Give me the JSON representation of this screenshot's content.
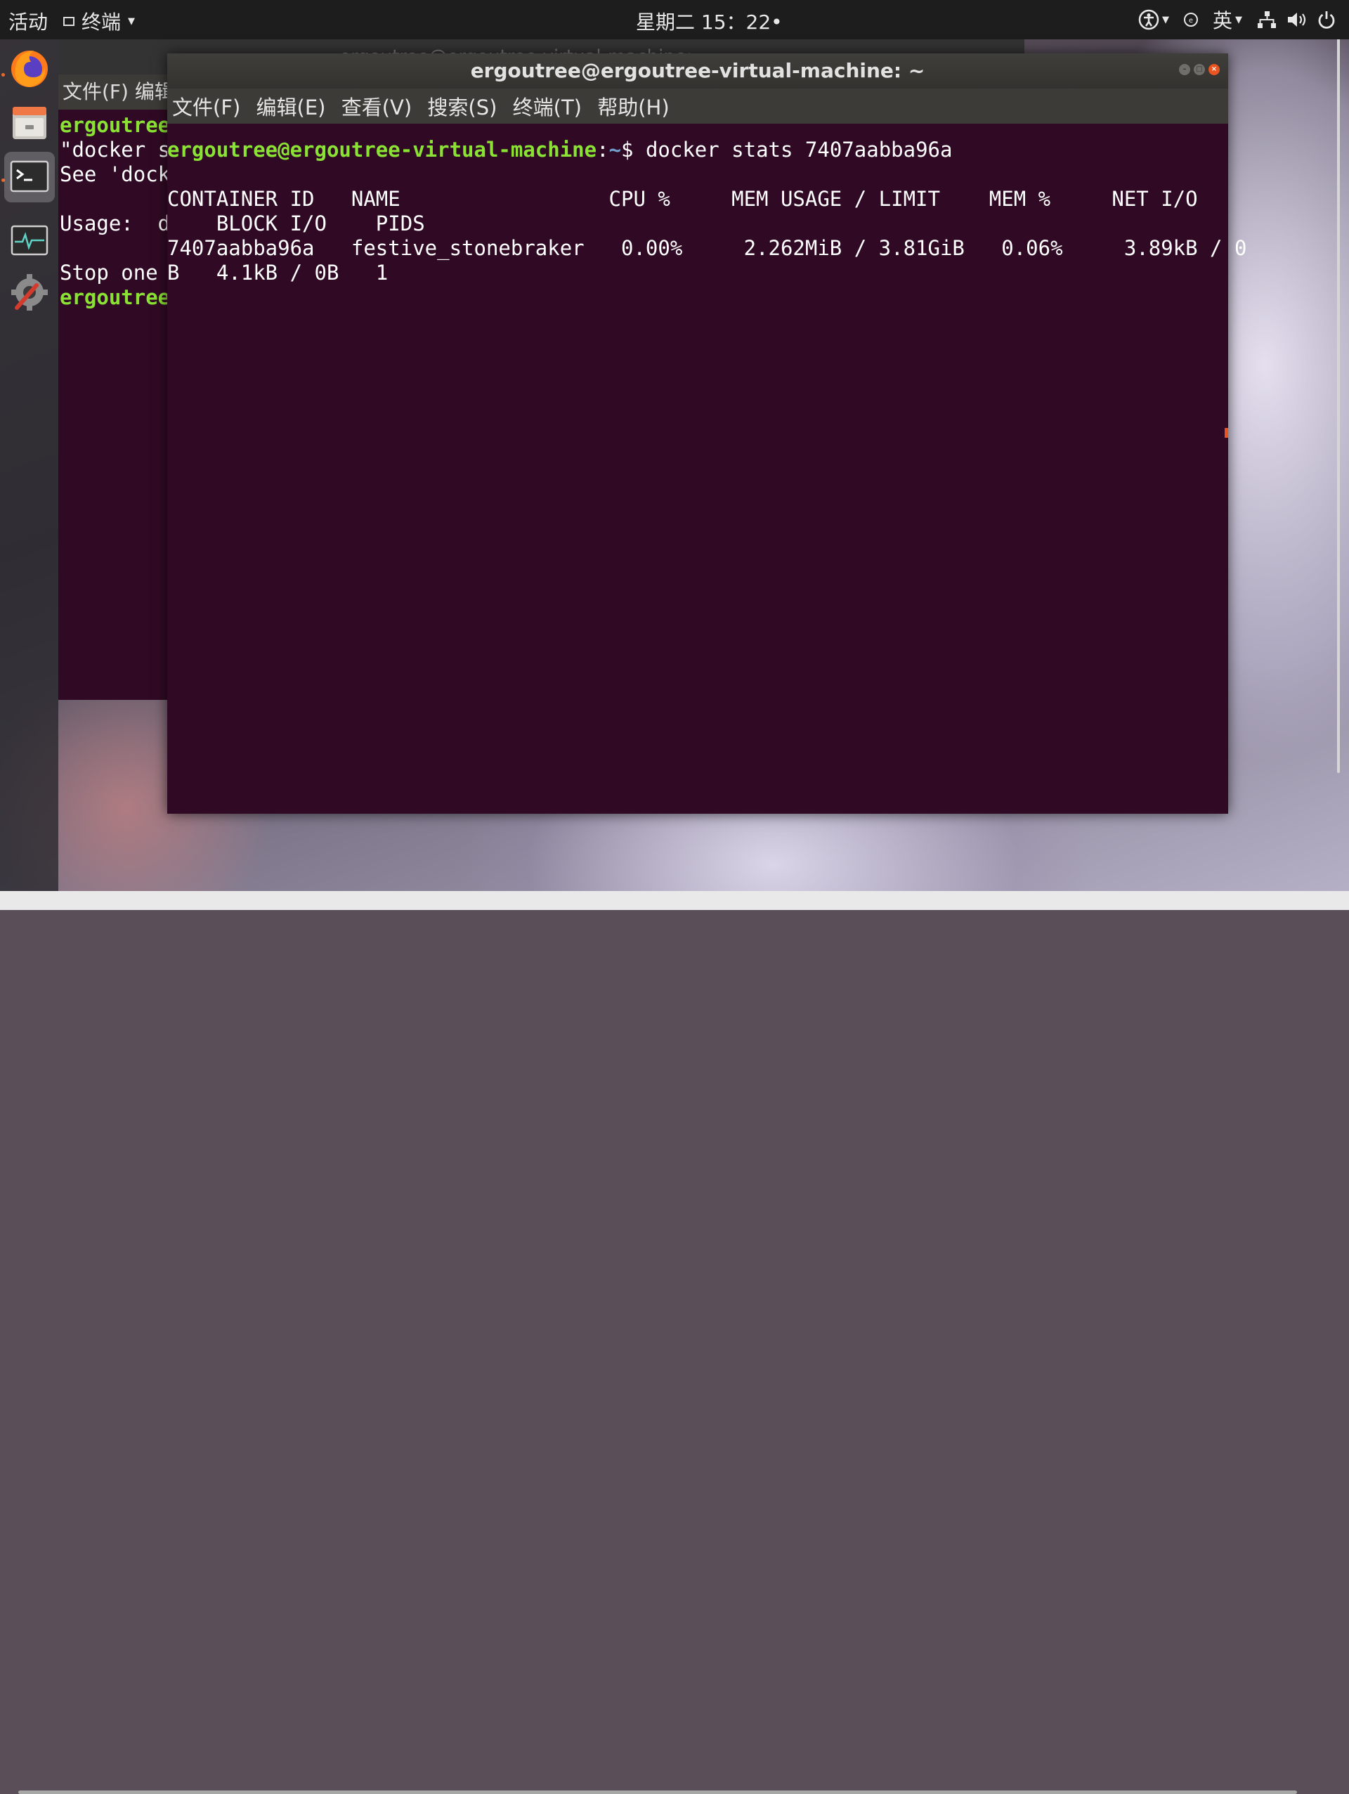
{
  "topbar": {
    "activities": "活动",
    "app_menu": "终端",
    "clock": "星期二 15：22•",
    "input_method": "英"
  },
  "dock": {
    "items": [
      {
        "name": "firefox",
        "icon": "firefox-icon"
      },
      {
        "name": "files",
        "icon": "files-icon"
      },
      {
        "name": "terminal",
        "icon": "terminal-icon"
      },
      {
        "name": "system-monitor",
        "icon": "system-monitor-icon"
      },
      {
        "name": "settings",
        "icon": "settings-icon"
      }
    ]
  },
  "bg_terminal": {
    "title": "ergoutree@ergoutree-virtual-machine: ~",
    "menu_partial": "文件(F)  编辑",
    "lines": [
      {
        "prompt": "ergoutree",
        "text": ""
      },
      {
        "prompt": "",
        "text": "\"docker s"
      },
      {
        "prompt": "",
        "text": "See 'dock"
      },
      {
        "prompt": "",
        "text": ""
      },
      {
        "prompt": "",
        "text": "Usage:  d"
      },
      {
        "prompt": "",
        "text": ""
      },
      {
        "prompt": "",
        "text": "Stop one"
      },
      {
        "prompt": "ergoutree",
        "text": ""
      }
    ]
  },
  "terminal": {
    "title": "ergoutree@ergoutree-virtual-machine: ~",
    "menu": [
      "文件(F)",
      "编辑(E)",
      "查看(V)",
      "搜索(S)",
      "终端(T)",
      "帮助(H)"
    ],
    "prompt_user": "ergoutree@ergoutree-virtual-machine",
    "prompt_sep": ":",
    "prompt_path": "~",
    "prompt_symbol": "$",
    "command": " docker stats 7407aabba96a",
    "output_lines": [
      "CONTAINER ID   NAME                 CPU %     MEM USAGE / LIMIT    MEM %     NET I/O",
      "    BLOCK I/O    PIDS",
      "7407aabba96a   festive_stonebraker   0.00%     2.262MiB / 3.81GiB   0.06%     3.89kB / 0",
      "B   4.1kB / 0B   1"
    ]
  }
}
